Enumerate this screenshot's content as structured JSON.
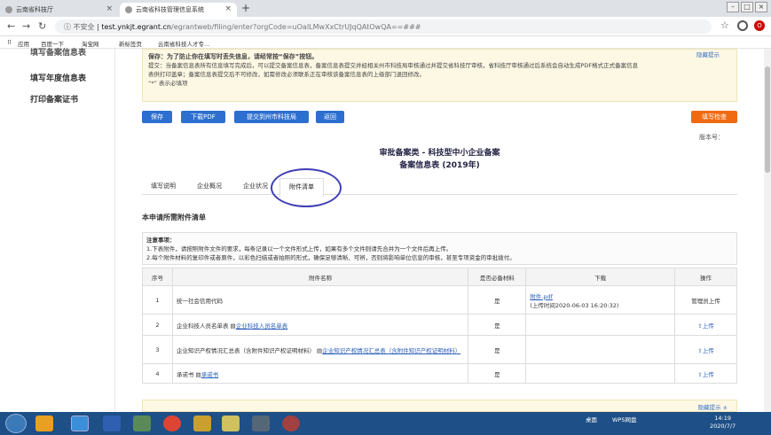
{
  "browser": {
    "tabs": [
      {
        "label": "云南省科技厅"
      },
      {
        "label": "云南省科技管理信息系统"
      }
    ],
    "url": {
      "security": "不安全",
      "domain": "test.ynkjt.egrant.cn",
      "path": "/egrantweb/filing/enter?orgCode=uOaILMwXxCtrUJqQAtOwQA==###"
    },
    "bookmarks": [
      "应用",
      "百度一下",
      "淘宝网",
      "新标签页",
      "云南省科技人才专..."
    ]
  },
  "sidebar": {
    "items": [
      "填写备案信息表",
      "填写年度信息表",
      "打印备案证书"
    ]
  },
  "notice": {
    "line1": "保存：为了防止你在填写时丢失信息，请经常按“保存”按钮。",
    "line2": "提交：当备案信息表所有信息填写完成后，可以提交备案信息表，备案信息表提交并经相关州市科技局审核通过并提交省科技厅审核，省科技厅审核通过后系统会自动生成PDF格式正式备案信息",
    "line3": "表供打印盖章；备案信息表提交后不可修改，如需修改必须联系正在审核该备案信息表的上级部门退回修改。",
    "line4": "“*” 表示必填项",
    "hide_tip": "隐藏提示"
  },
  "toolbar": {
    "save": "保存",
    "download_pdf": "下载PDF",
    "submit": "提交到州市科技局",
    "back": "返回",
    "check": "填写检查"
  },
  "version_label": "版本号：",
  "form": {
    "title1": "审批备案类 - 科技型中小企业备案",
    "title2": "备案信息表 (2019年)"
  },
  "form_tabs": [
    "填写说明",
    "企业概况",
    "企业状况",
    "附件清单"
  ],
  "section_title": "本申请所需附件清单",
  "attention": {
    "title": "注意事项：",
    "line1": "1.下表附件，请按照附件文件的要求，每条记录以一个文件形式上传，如果有多个文件则请先合并为一个文件后再上传。",
    "line2": "2.每个附件材料的复印件或者原件，以彩色扫描或者拍照的形式，确保足够清晰、可辨，否则将影响单位信息的审核，甚至专项资金的审批拨付。"
  },
  "table": {
    "headers": [
      "序号",
      "附件名称",
      "是否必备材料",
      "下载",
      "操作"
    ],
    "rows": [
      {
        "no": "1",
        "name": "统一社会信用代码",
        "template": "",
        "required": "是",
        "file": "附件.pdf",
        "upload_time": "(上传时间2020-06-03 16:20:32)",
        "action": "管理员上传"
      },
      {
        "no": "2",
        "name": "企业科技人员名单表",
        "template": "企业科技人员名单表",
        "required": "是",
        "file": "",
        "upload_time": "",
        "action": "上传"
      },
      {
        "no": "3",
        "name": "企业知识产权情况汇总表（含附件知识产权证明材料）",
        "template": "企业知识产权情况汇总表（含附件知识产权证明材料）",
        "required": "是",
        "file": "",
        "upload_time": "",
        "action": "上传"
      },
      {
        "no": "4",
        "name": "承诺书",
        "template": "承诺书",
        "required": "是",
        "file": "",
        "upload_time": "",
        "action": "上传"
      }
    ]
  },
  "bottom_tip": "隐藏提示 ±",
  "taskbar": {
    "tray_label1": "桌面",
    "tray_label2": "WPS网盘",
    "time": "14:19",
    "date": "2020/7/7"
  }
}
